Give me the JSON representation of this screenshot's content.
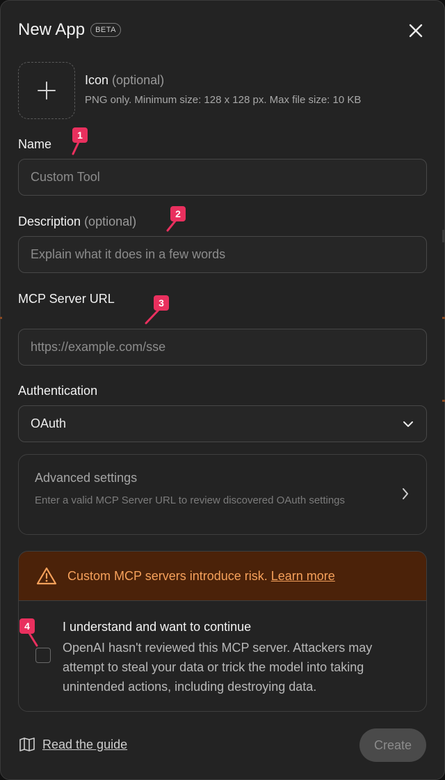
{
  "dialog": {
    "title": "New App",
    "badge": "BETA"
  },
  "icon_upload": {
    "label": "Icon",
    "optional": "(optional)",
    "hint": "PNG only. Minimum size: 128 x 128 px. Max file size: 10 KB"
  },
  "fields": {
    "name": {
      "label": "Name",
      "placeholder": "Custom Tool"
    },
    "description": {
      "label": "Description",
      "optional": "(optional)",
      "placeholder": "Explain what it does in a few words"
    },
    "server_url": {
      "label": "MCP Server URL",
      "placeholder": "https://example.com/sse"
    },
    "authentication": {
      "label": "Authentication",
      "value": "OAuth"
    }
  },
  "advanced": {
    "title": "Advanced settings",
    "description": "Enter a valid MCP Server URL to review discovered OAuth settings"
  },
  "risk": {
    "warning": "Custom MCP servers introduce risk.",
    "link": "Learn more",
    "consent_title": "I understand and want to continue",
    "consent_body": "OpenAI hasn't reviewed this MCP server. Attackers may attempt to steal your data or trick the model into taking unintended actions, including destroying data."
  },
  "footer": {
    "guide": "Read the guide",
    "create": "Create"
  },
  "markers": [
    "1",
    "2",
    "3",
    "4"
  ],
  "colors": {
    "background": "#232323",
    "warning_bg": "#4b2209",
    "warning_text": "#f6a15b",
    "marker": "#e9305e"
  }
}
